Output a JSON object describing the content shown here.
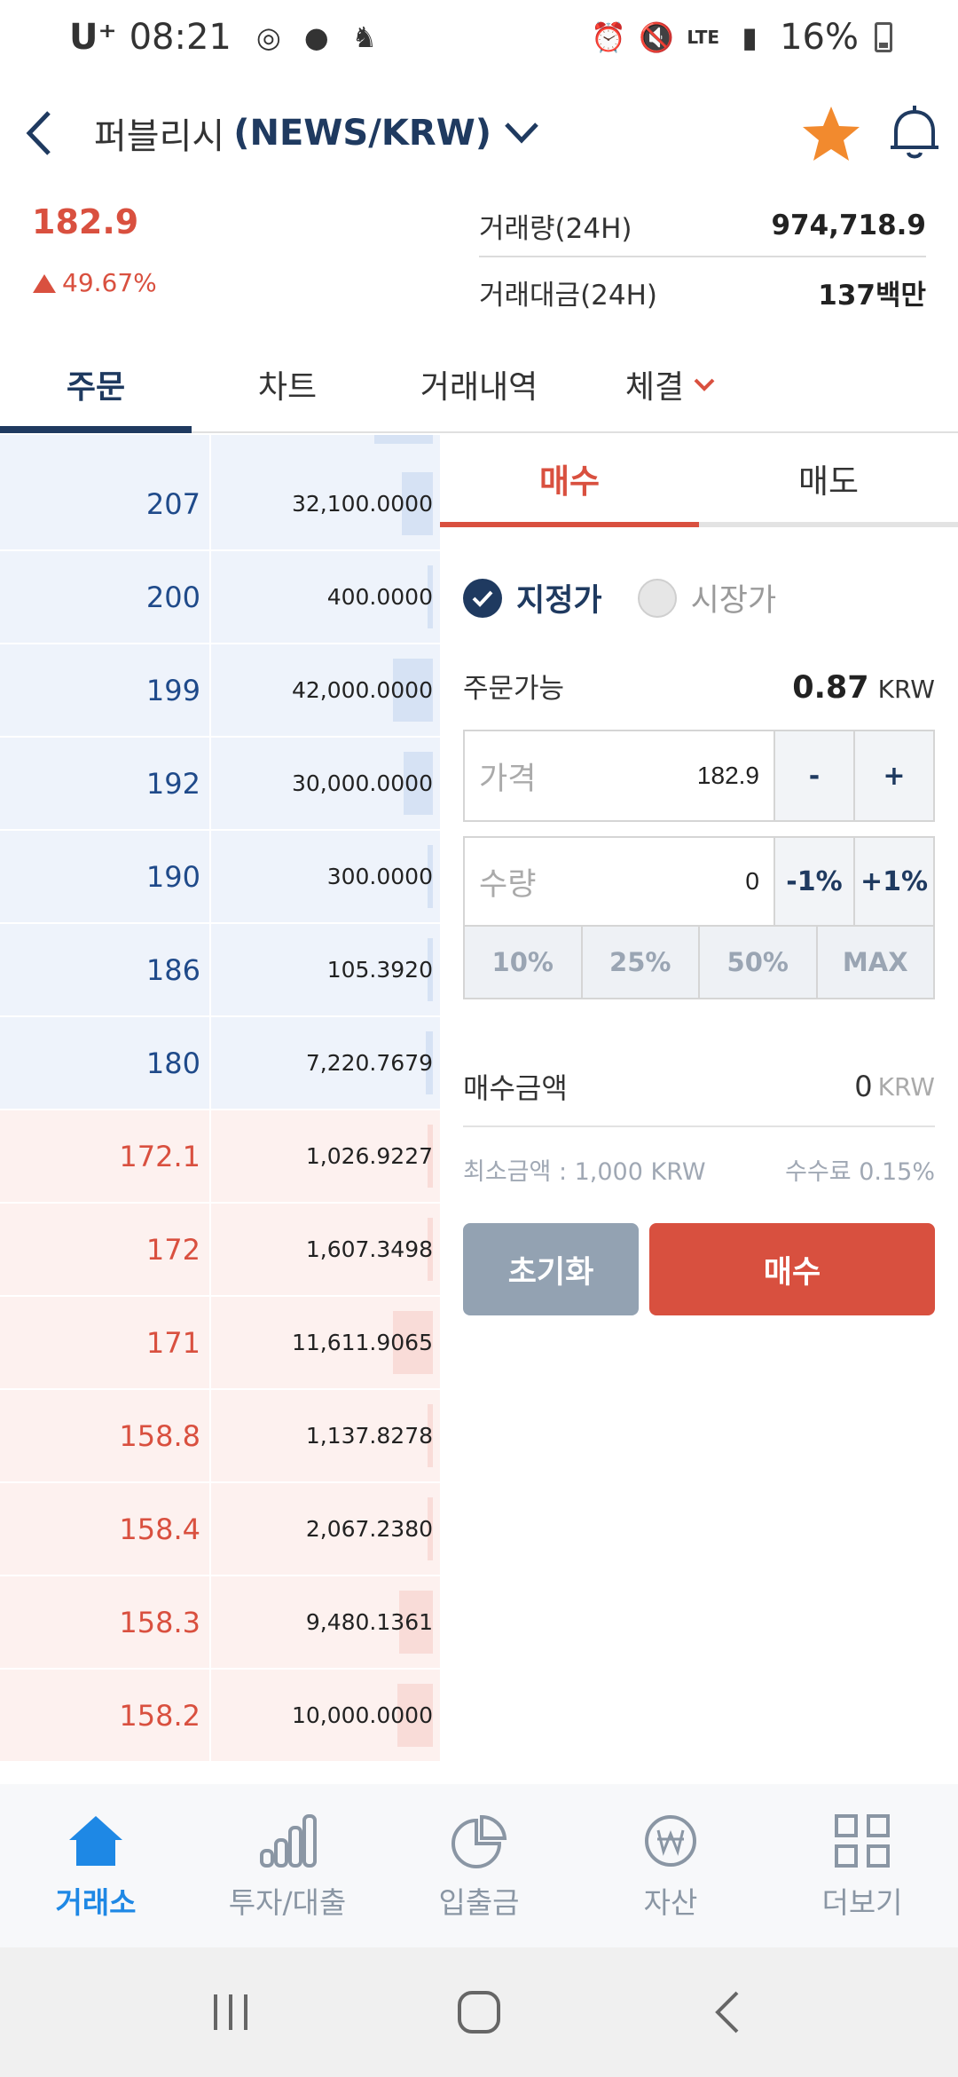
{
  "statusbar": {
    "carrier": "U⁺",
    "time": "08:21",
    "battery": "16%",
    "network": "LTE"
  },
  "header": {
    "coin_name": "퍼블리시",
    "pair": "(NEWS/KRW)"
  },
  "ticker": {
    "price": "182.9",
    "change": "49.67%",
    "volume_label": "거래량(24H)",
    "volume_value": "974,718.9",
    "amount_label": "거래대금(24H)",
    "amount_value": "137백만"
  },
  "tabs": [
    "주문",
    "차트",
    "거래내역",
    "체결"
  ],
  "orderbook": {
    "asks": [
      {
        "price": "207",
        "qty": "32,100.0000",
        "depth": 0.14
      },
      {
        "price": "200",
        "qty": "400.0000",
        "depth": 0.0
      },
      {
        "price": "199",
        "qty": "42,000.0000",
        "depth": 0.18
      },
      {
        "price": "192",
        "qty": "30,000.0000",
        "depth": 0.13
      },
      {
        "price": "190",
        "qty": "300.0000",
        "depth": 0.0
      },
      {
        "price": "186",
        "qty": "105.3920",
        "depth": 0.0
      },
      {
        "price": "180",
        "qty": "7,220.7679",
        "depth": 0.03
      }
    ],
    "bids": [
      {
        "price": "172.1",
        "qty": "1,026.9227",
        "depth": 0.01
      },
      {
        "price": "172",
        "qty": "1,607.3498",
        "depth": 0.01
      },
      {
        "price": "171",
        "qty": "11,611.9065",
        "depth": 0.18
      },
      {
        "price": "158.8",
        "qty": "1,137.8278",
        "depth": 0.01
      },
      {
        "price": "158.4",
        "qty": "2,067.2380",
        "depth": 0.02
      },
      {
        "price": "158.3",
        "qty": "9,480.1361",
        "depth": 0.15
      },
      {
        "price": "158.2",
        "qty": "10,000.0000",
        "depth": 0.16
      }
    ]
  },
  "order": {
    "buy_tab": "매수",
    "sell_tab": "매도",
    "limit_label": "지정가",
    "market_label": "시장가",
    "available_label": "주문가능",
    "available_amount": "0.87",
    "currency": "KRW",
    "price_placeholder": "가격",
    "price_value": "182.9",
    "minus": "-",
    "plus": "+",
    "qty_placeholder": "수량",
    "qty_value": "0",
    "minus_pct": "-1%",
    "plus_pct": "+1%",
    "percents": [
      "10%",
      "25%",
      "50%",
      "MAX"
    ],
    "total_label": "매수금액",
    "total_value": "0",
    "min_amount": "최소금액 : 1,000 KRW",
    "fee": "수수료 0.15%",
    "reset_label": "초기화",
    "buy_label": "매수"
  },
  "bottomnav": [
    "거래소",
    "투자/대출",
    "입출금",
    "자산",
    "더보기"
  ],
  "colors": {
    "primary": "#1f3a60",
    "bid": "#d9503f",
    "ask": "#1f4a8a",
    "accent": "#1e88e5"
  }
}
